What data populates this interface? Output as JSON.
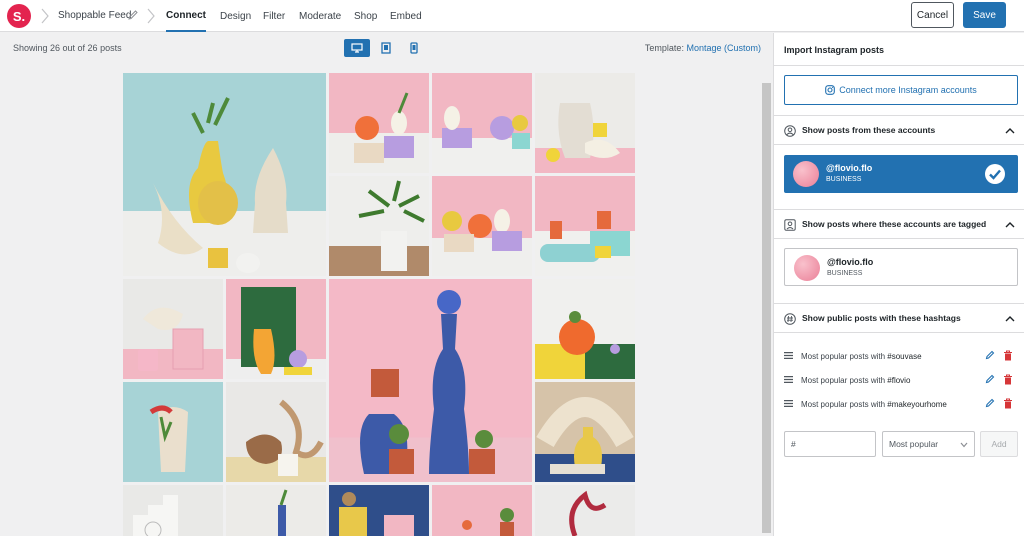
{
  "app": {
    "logo": "S."
  },
  "header": {
    "feed_name": "Shoppable Feed",
    "tabs": [
      {
        "label": "Connect",
        "active": true
      },
      {
        "label": "Design"
      },
      {
        "label": "Filter"
      },
      {
        "label": "Moderate"
      },
      {
        "label": "Shop"
      },
      {
        "label": "Embed"
      }
    ],
    "cancel_label": "Cancel",
    "save_label": "Save"
  },
  "preview": {
    "showing_text": "Showing 26 out of 26 posts",
    "template_label": "Template:",
    "template_value": "Montage (Custom)",
    "devices": [
      "desktop-icon",
      "tablet-icon",
      "mobile-icon"
    ],
    "active_device": "desktop"
  },
  "panel": {
    "title": "Import Instagram posts",
    "connect_label": "Connect more Instagram accounts",
    "sections": {
      "from_accounts": "Show posts from these accounts",
      "tagged": "Show posts where these accounts are tagged",
      "hashtags": "Show public posts with these hashtags"
    },
    "accounts": [
      {
        "handle": "@flovio.flo",
        "type": "BUSINESS",
        "selected": true
      }
    ],
    "tagged_accounts": [
      {
        "handle": "@flovio.flo",
        "type": "BUSINESS"
      }
    ],
    "hashtag_prefix": "Most popular posts with",
    "hashtags": [
      "#souvase",
      "#flovio",
      "#makeyourhome"
    ],
    "hashtag_input_placeholder": "#",
    "sort_option": "Most popular",
    "add_label": "Add"
  },
  "colors": {
    "accent": "#2271b1",
    "brand": "#e3244f",
    "delete": "#d63638"
  }
}
